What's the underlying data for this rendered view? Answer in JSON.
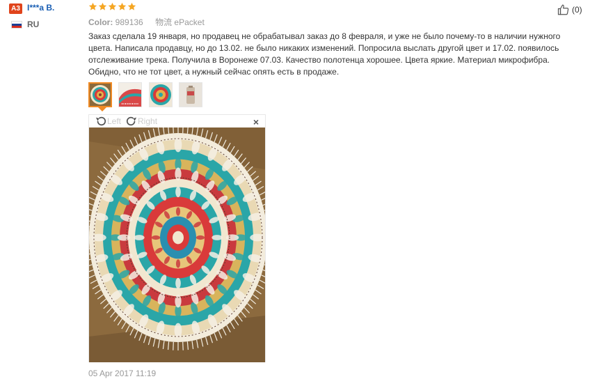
{
  "reviewer": {
    "level": "A3",
    "name": "I***a B.",
    "country": "RU",
    "flag_colors": [
      "#ffffff",
      "#1c3f94",
      "#d52b1e"
    ]
  },
  "review": {
    "rating": 5,
    "rating_max": 5,
    "star_color": "#f5a623",
    "color_label": "Color:",
    "color_value": "989136",
    "shipping_label": "物流",
    "shipping_value": "ePacket",
    "helpful_count": "(0)",
    "text": "Заказ сделала 19 января, но продавец не обрабатывал заказ до 8 февраля, и уже не было почему-то в наличии нужного цвета. Написала продавцу, но до 13.02. не было никаких изменений. Попросила выслать другой цвет и 17.02. появилось отслеживание трека. Получила в Воронеже 07.03. Качество полотенца хорошее. Цвета яркие. Материал микрофибра. Обидно, что не тот цвет, а нужный сейчас опять есть в продаже.",
    "date": "05 Apr 2017 11:19"
  },
  "thumbnails": [
    {
      "label": "photo-1",
      "active": true
    },
    {
      "label": "photo-2",
      "active": false
    },
    {
      "label": "photo-3",
      "active": false
    },
    {
      "label": "photo-4",
      "active": false
    }
  ],
  "viewer": {
    "rotate_left_label": "Left",
    "rotate_right_label": "Right",
    "close_icon": "close-icon"
  },
  "palette": {
    "accent": "#f08a24",
    "link": "#1a5fb4",
    "badge": "#e0441c"
  }
}
